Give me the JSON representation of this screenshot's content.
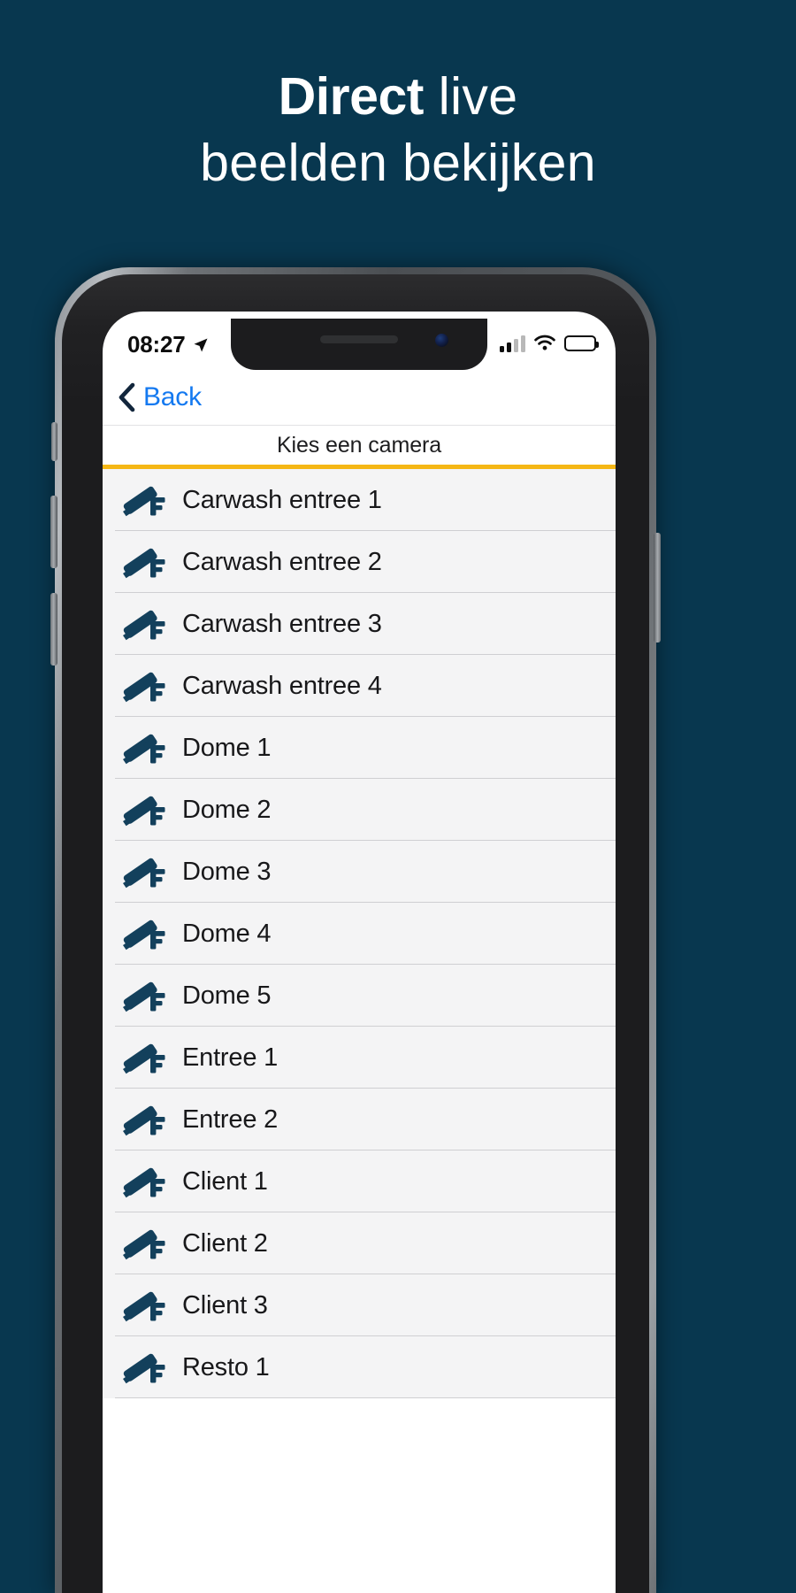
{
  "headline": {
    "line1_bold": "Direct",
    "line1_light": " live",
    "line2": "beelden bekijken"
  },
  "colors": {
    "background": "#08374f",
    "accent_rule": "#f5b715",
    "link_blue": "#1479f0",
    "icon_navy": "#13405c",
    "list_background": "#f4f4f5"
  },
  "phone": {
    "status_bar": {
      "time": "08:27",
      "location_icon": "location-arrow-icon",
      "signal_icon": "cellular-signal-icon",
      "signal_bars_filled": 2,
      "signal_bars_total": 4,
      "wifi_icon": "wifi-icon",
      "battery_icon": "battery-full-icon",
      "battery_level": 100
    },
    "nav_bar": {
      "back_icon": "chevron-left-icon",
      "back_label": "Back"
    },
    "section": {
      "title": "Kies een camera"
    },
    "camera_icon_name": "cctv-camera-icon",
    "cameras": [
      {
        "label": "Carwash entree 1"
      },
      {
        "label": "Carwash entree 2"
      },
      {
        "label": "Carwash entree 3"
      },
      {
        "label": "Carwash entree 4"
      },
      {
        "label": "Dome 1"
      },
      {
        "label": "Dome 2"
      },
      {
        "label": "Dome 3"
      },
      {
        "label": "Dome 4"
      },
      {
        "label": "Dome 5"
      },
      {
        "label": "Entree 1"
      },
      {
        "label": "Entree 2"
      },
      {
        "label": "Client 1"
      },
      {
        "label": "Client 2"
      },
      {
        "label": "Client 3"
      },
      {
        "label": "Resto 1"
      }
    ]
  }
}
